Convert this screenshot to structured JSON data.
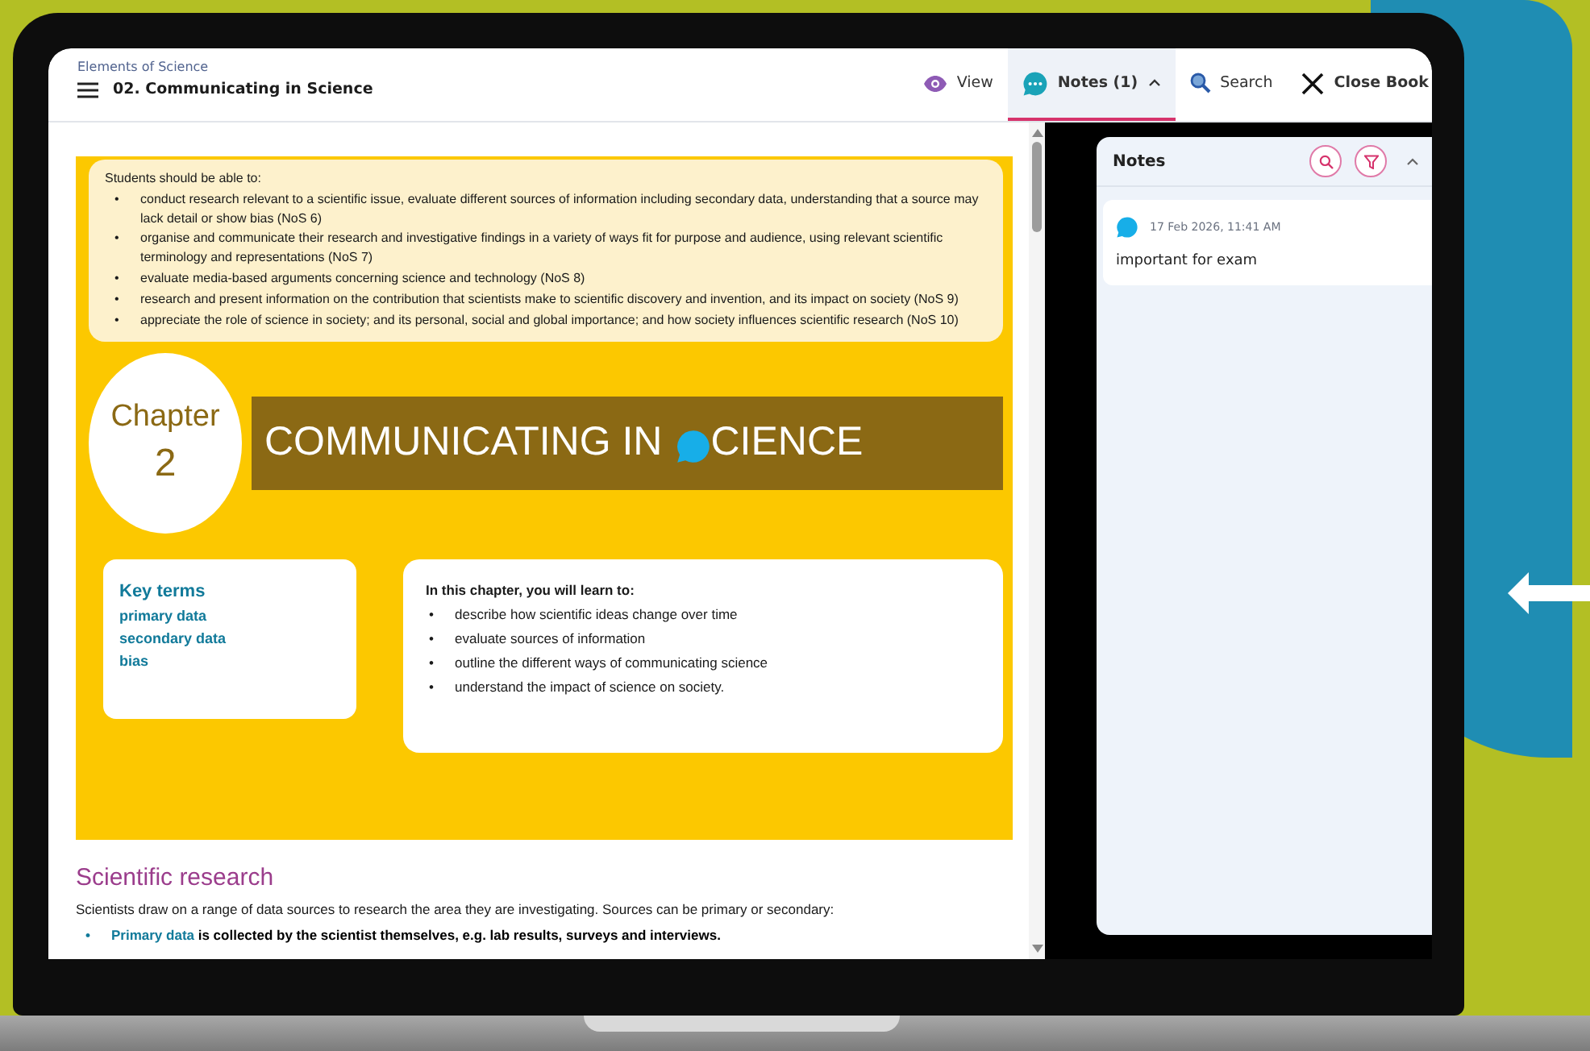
{
  "book": {
    "series_title": "Elements of Science",
    "chapter_title": "02. Communicating in Science"
  },
  "toolbar": [
    {
      "kind": "view",
      "label": "View",
      "selected": false
    },
    {
      "kind": "notes",
      "label": "Notes (1)",
      "selected": true
    },
    {
      "kind": "search",
      "label": "Search",
      "selected": false
    },
    {
      "kind": "close",
      "label": "Close Book",
      "selected": false
    }
  ],
  "objectives": {
    "intro": "Students should be able to:",
    "items": [
      {
        "bullet": "•",
        "text": "conduct research relevant to a scientific issue, evaluate different sources of information including secondary data, understanding that a source may lack detail or show bias (NoS 6)"
      },
      {
        "bullet": "•",
        "text": "organise and communicate their research and investigative findings in a variety of ways fit for purpose and audience, using relevant scientific terminology and representations (NoS 7)"
      },
      {
        "bullet": "•",
        "text": "evaluate media-based arguments concerning science and technology (NoS 8)"
      },
      {
        "bullet": "•",
        "text": "research and present information on the contribution that scientists make to scientific discovery and invention, and its impact on society (NoS 9)"
      },
      {
        "bullet": "•",
        "text": "appreciate the role of science in society; and its personal, social and global importance; and how society influences scientific research (NoS 10)"
      }
    ]
  },
  "chapter": {
    "label": "Chapter",
    "number": "2",
    "title_start": "COMMUNICATING IN",
    "title_end": "CIENCE"
  },
  "key_terms": {
    "heading": "Key terms",
    "terms": [
      "primary data",
      "secondary data",
      "bias"
    ]
  },
  "learn": {
    "heading": "In this chapter, you will learn to:",
    "items": [
      {
        "bullet": "•",
        "text": "describe how scientific ideas change over time"
      },
      {
        "bullet": "•",
        "text": "evaluate sources of information"
      },
      {
        "bullet": "•",
        "text": "outline the different ways of communicating science"
      },
      {
        "bullet": "•",
        "text": "understand the impact of science on society."
      }
    ]
  },
  "section": {
    "heading": "Scientific research",
    "paragraph": "Scientists draw on a range of data sources to research the area they are investigating. Sources can be primary or secondary:",
    "bullets": [
      {
        "bullet": "•",
        "term": "Primary data",
        "text": " is collected by the scientist themselves, e.g. lab results, surveys and interviews."
      }
    ]
  },
  "notes_panel": {
    "title": "Notes",
    "notes": [
      {
        "date": "17 Feb 2026, 11:41 AM",
        "text": "important for exam"
      }
    ]
  }
}
